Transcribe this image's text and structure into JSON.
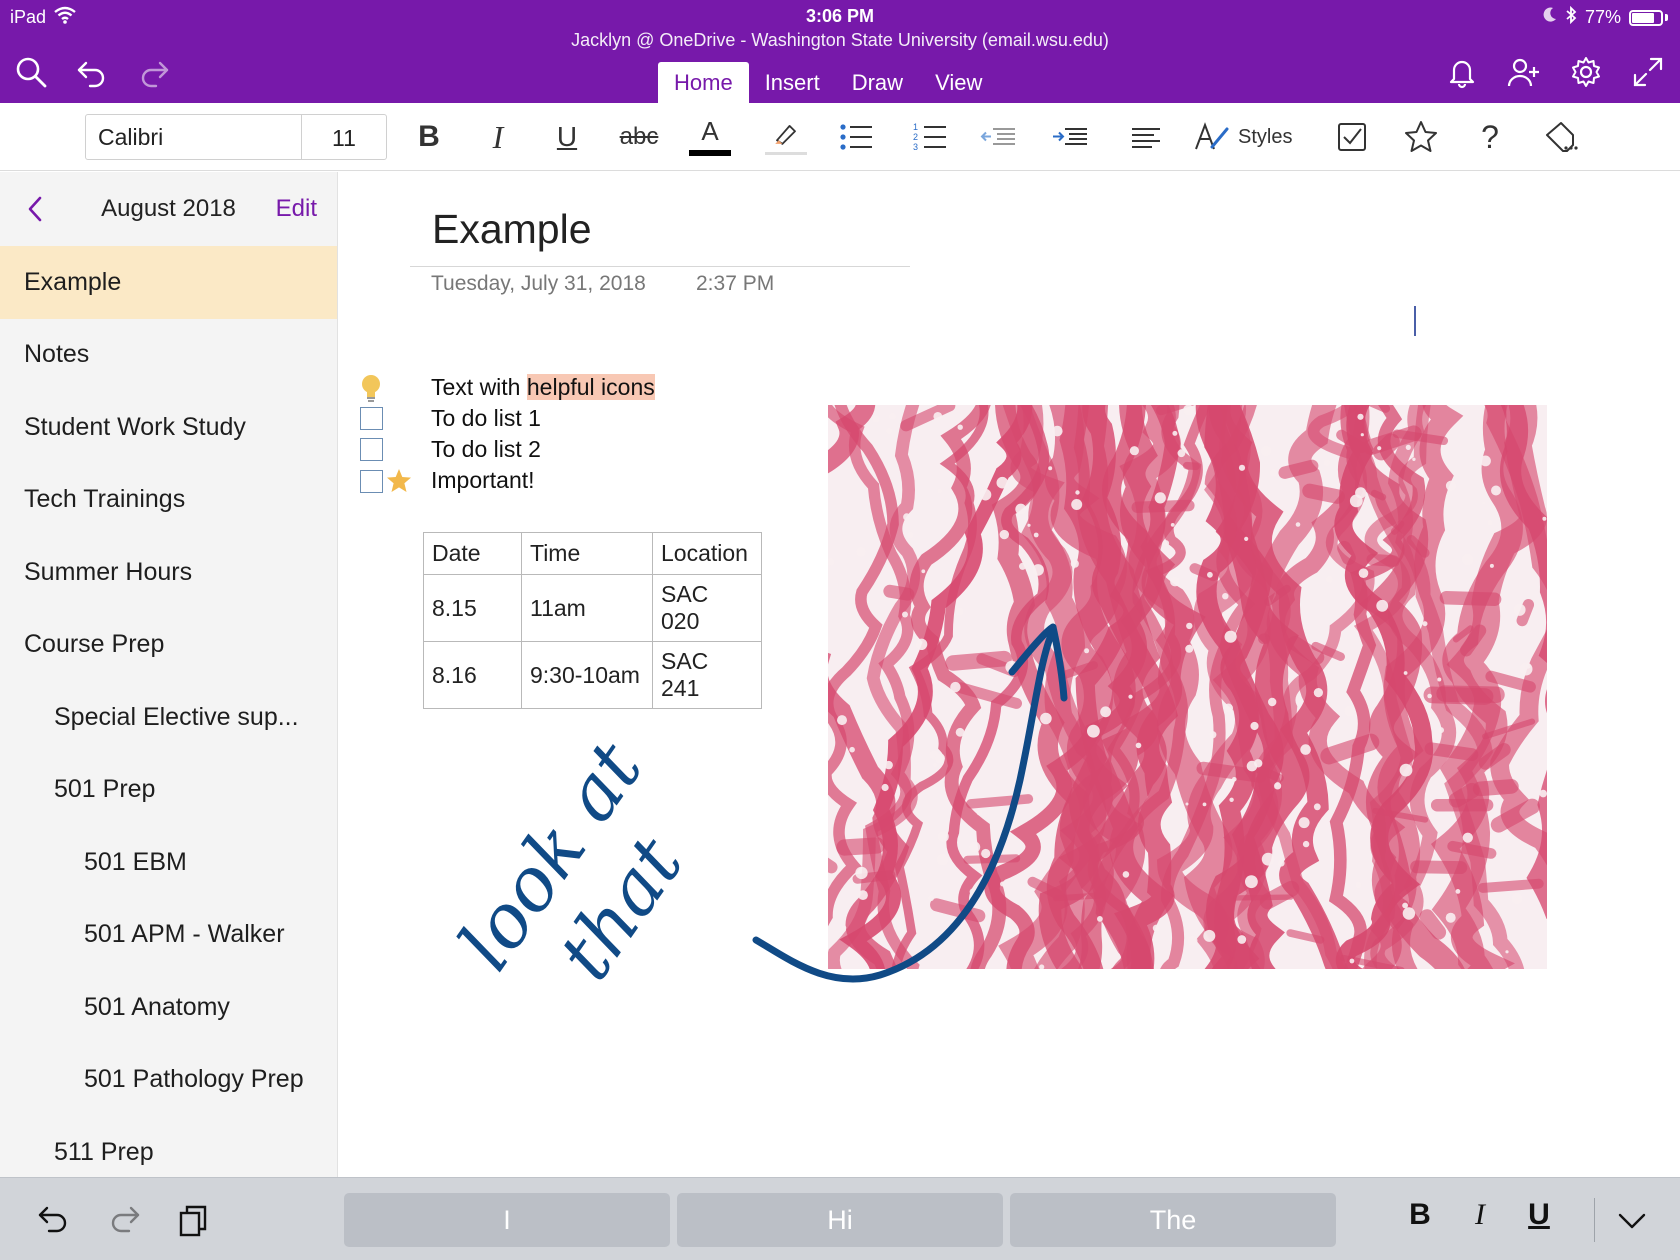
{
  "status_bar": {
    "device": "iPad",
    "time": "3:06 PM",
    "battery": "77%",
    "battery_level": 0.77
  },
  "header": {
    "account": "Jacklyn @ OneDrive - Washington State University (email.wsu.edu)",
    "tabs": [
      {
        "label": "Home",
        "active": true
      },
      {
        "label": "Insert",
        "active": false
      },
      {
        "label": "Draw",
        "active": false
      },
      {
        "label": "View",
        "active": false
      }
    ],
    "left_icons": [
      "search-icon",
      "undo-icon",
      "redo-icon"
    ],
    "right_icons": [
      "bell-icon",
      "add-person-icon",
      "gear-icon",
      "fullscreen-icon"
    ]
  },
  "ribbon": {
    "font_name": "Calibri",
    "font_size": "11",
    "bold": "B",
    "italic": "I",
    "underline": "U",
    "strike": "abc",
    "font_color_letter": "A",
    "styles_label": "Styles",
    "help": "?",
    "font_color": "#000000",
    "highlight_color": "#f3a06c"
  },
  "sidebar": {
    "section_title": "August 2018",
    "edit_label": "Edit",
    "pages": [
      {
        "label": "Example",
        "level": 0,
        "selected": true
      },
      {
        "label": "Notes",
        "level": 0
      },
      {
        "label": "Student Work Study",
        "level": 0
      },
      {
        "label": "Tech Trainings",
        "level": 0
      },
      {
        "label": "Summer Hours",
        "level": 0
      },
      {
        "label": "Course Prep",
        "level": 0
      },
      {
        "label": "Special Elective sup...",
        "level": 1
      },
      {
        "label": "501 Prep",
        "level": 1
      },
      {
        "label": "501 EBM",
        "level": 2
      },
      {
        "label": "501 APM - Walker",
        "level": 2
      },
      {
        "label": "501 Anatomy",
        "level": 2
      },
      {
        "label": "501 Pathology Prep",
        "level": 2
      },
      {
        "label": "511 Prep",
        "level": 1
      }
    ]
  },
  "page": {
    "title": "Example",
    "date": "Tuesday, July 31, 2018",
    "time": "2:37 PM",
    "note_prefix": "Text with ",
    "note_highlight": "helpful icons",
    "todos": [
      "To do list 1",
      "To do list 2"
    ],
    "important": "Important!",
    "table": {
      "headers": [
        "Date",
        "Time",
        "Location"
      ],
      "rows": [
        [
          "8.15",
          "11am",
          "SAC 020"
        ],
        [
          "8.16",
          "9:30-10am",
          "SAC 241"
        ]
      ]
    },
    "ink_text_line1": "look at",
    "ink_text_line2": "that",
    "ink_color": "#104a86",
    "image_palette": {
      "tissue": "#d6486e",
      "background": "#f8eef1"
    }
  },
  "keyboard_bar": {
    "suggestions": [
      "I",
      "Hi",
      "The"
    ],
    "bold": "B",
    "italic": "I",
    "underline": "U"
  }
}
